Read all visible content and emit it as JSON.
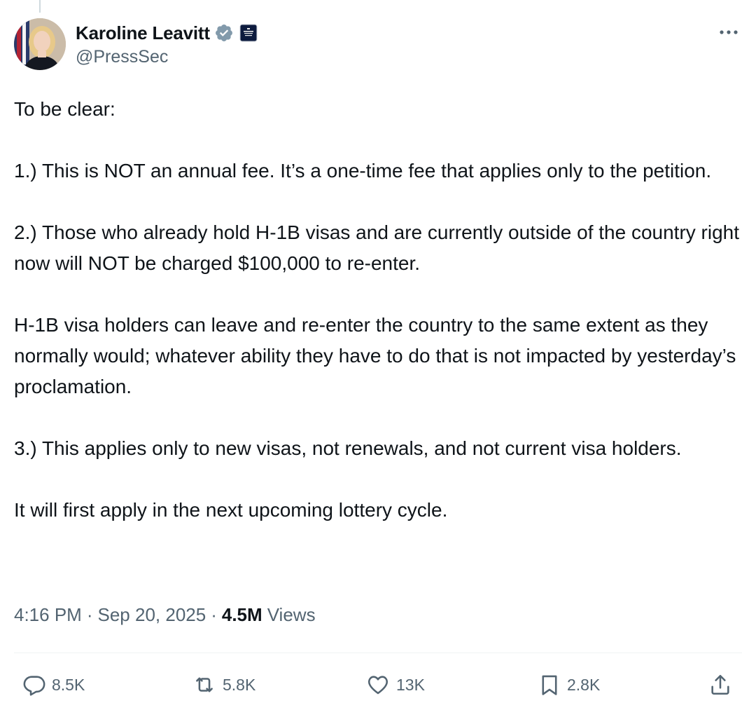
{
  "author": {
    "display_name": "Karoline Leavitt",
    "handle": "@PressSec",
    "verified_icon": "verified-badge-gray",
    "affiliate_icon": "white-house-badge"
  },
  "tweet": {
    "paragraphs": [
      "To be clear:",
      "1.) This is NOT an annual fee. It’s a one-time fee that applies only to the petition.",
      "2.) Those who already hold H-1B visas and are currently outside of the country right now will NOT be charged $100,000 to re-enter.",
      "H-1B visa holders can leave and re-enter the country to the same extent as they normally would; whatever ability they have to do that is not impacted by yesterday’s proclamation.",
      "3.) This applies only to new visas, not renewals, and not current visa holders.",
      "It will first apply in the next upcoming lottery cycle."
    ]
  },
  "meta": {
    "time": "4:16 PM",
    "separator": "·",
    "date": "Sep 20, 2025",
    "views_count": "4.5M",
    "views_label": "Views"
  },
  "actions": {
    "replies": "8.5K",
    "reposts": "5.8K",
    "likes": "13K",
    "bookmarks": "2.8K"
  },
  "colors": {
    "text_primary": "#0f1419",
    "text_secondary": "#536471",
    "divider": "#eff3f4",
    "verified_gray": "#829aab"
  }
}
